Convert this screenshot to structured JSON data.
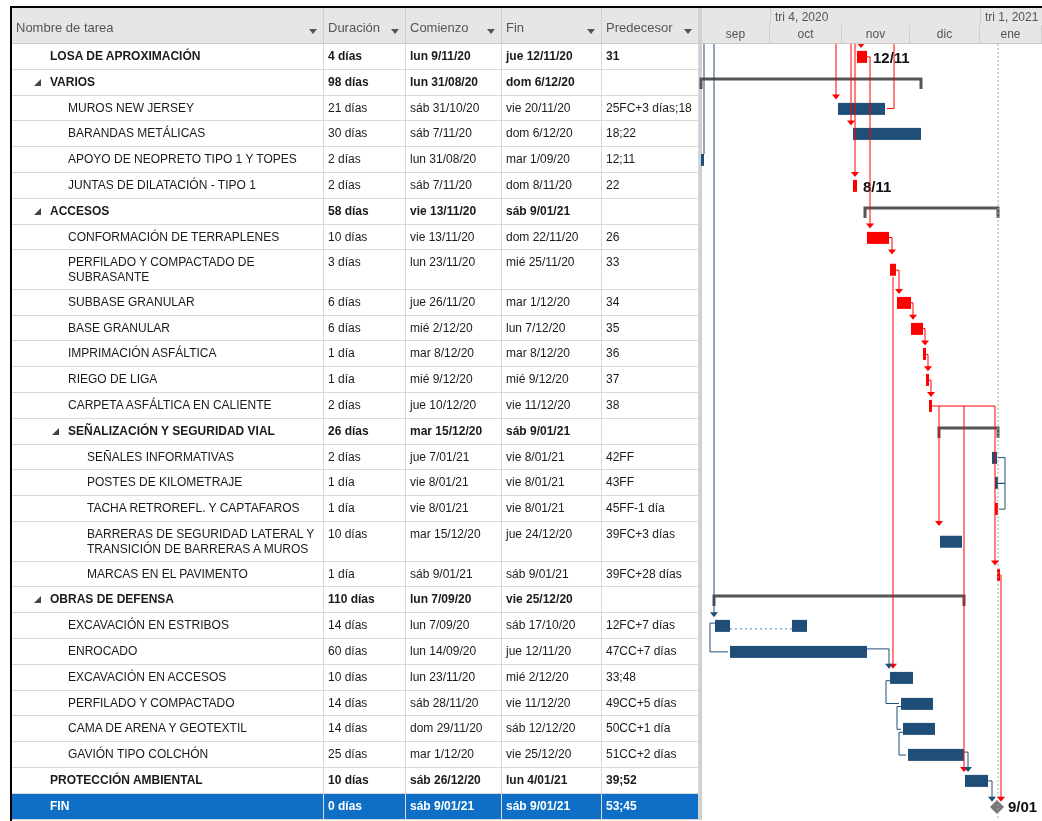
{
  "columns": [
    "Nombre de tarea",
    "Duración",
    "Comienzo",
    "Fin",
    "Predecesor"
  ],
  "timescale": {
    "quarters": [
      "tri 4, 2020",
      "tri 1, 2021"
    ],
    "months": [
      "sep",
      "oct",
      "nov",
      "dic",
      "ene"
    ]
  },
  "tasks": [
    {
      "name": "LOSA DE APROXIMACIÓN",
      "duration": "4 días",
      "start": "lun 9/11/20",
      "finish": "jue 12/11/20",
      "predecessors": "31",
      "kind": "task",
      "critical": true,
      "selected": false,
      "gantt_label": "12/11"
    },
    {
      "name": "VARIOS",
      "duration": "98 días",
      "start": "lun 31/08/20",
      "finish": "dom 6/12/20",
      "kind": "summary",
      "expanded": true,
      "selected": false,
      "children": [
        {
          "name": "MUROS NEW JERSEY",
          "duration": "21 días",
          "start": "sáb 31/10/20",
          "finish": "vie 20/11/20",
          "predecessors": "25FC+3 días;18",
          "kind": "task",
          "critical": false,
          "selected": false
        },
        {
          "name": "BARANDAS METÁLICAS",
          "duration": "30 días",
          "start": "sáb 7/11/20",
          "finish": "dom 6/12/20",
          "predecessors": "18;22",
          "kind": "task",
          "critical": false,
          "selected": false
        },
        {
          "name": "APOYO DE NEOPRETO TIPO 1 Y TOPES",
          "duration": "2 días",
          "start": "lun 31/08/20",
          "finish": "mar 1/09/20",
          "predecessors": "12;11",
          "kind": "task",
          "critical": false,
          "selected": false
        },
        {
          "name": "JUNTAS DE DILATACIÓN - TIPO 1",
          "duration": "2 días",
          "start": "sáb 7/11/20",
          "finish": "dom 8/11/20",
          "predecessors": "22",
          "kind": "task",
          "critical": true,
          "selected": false,
          "gantt_label": "8/11"
        }
      ]
    },
    {
      "name": "ACCESOS",
      "duration": "58 días",
      "start": "vie 13/11/20",
      "finish": "sáb 9/01/21",
      "kind": "summary",
      "expanded": true,
      "selected": false,
      "children": [
        {
          "name": "CONFORMACIÓN DE TERRAPLENES",
          "duration": "10 días",
          "start": "vie 13/11/20",
          "finish": "dom 22/11/20",
          "predecessors": "26",
          "kind": "task",
          "critical": true,
          "selected": false
        },
        {
          "name": "PERFILADO Y COMPACTADO DE SUBRASANTE",
          "duration": "3 días",
          "start": "lun 23/11/20",
          "finish": "mié 25/11/20",
          "predecessors": "33",
          "kind": "task",
          "critical": true,
          "selected": false
        },
        {
          "name": "SUBBASE GRANULAR",
          "duration": "6 días",
          "start": "jue 26/11/20",
          "finish": "mar 1/12/20",
          "predecessors": "34",
          "kind": "task",
          "critical": true,
          "selected": false
        },
        {
          "name": "BASE GRANULAR",
          "duration": "6 días",
          "start": "mié 2/12/20",
          "finish": "lun 7/12/20",
          "predecessors": "35",
          "kind": "task",
          "critical": true,
          "selected": false
        },
        {
          "name": "IMPRIMACIÓN ASFÁLTICA",
          "duration": "1 día",
          "start": "mar 8/12/20",
          "finish": "mar 8/12/20",
          "predecessors": "36",
          "kind": "task",
          "critical": true,
          "selected": false
        },
        {
          "name": "RIEGO DE LIGA",
          "duration": "1 día",
          "start": "mié 9/12/20",
          "finish": "mié 9/12/20",
          "predecessors": "37",
          "kind": "task",
          "critical": true,
          "selected": false
        },
        {
          "name": "CARPETA ASFÁLTICA EN CALIENTE",
          "duration": "2 días",
          "start": "jue 10/12/20",
          "finish": "vie 11/12/20",
          "predecessors": "38",
          "kind": "task",
          "critical": true,
          "selected": false
        },
        {
          "name": "SEÑALIZACIÓN Y SEGURIDAD VIAL",
          "duration": "26 días",
          "start": "mar 15/12/20",
          "finish": "sáb 9/01/21",
          "kind": "summary",
          "expanded": true,
          "selected": false,
          "children": [
            {
              "name": "SEÑALES INFORMATIVAS",
              "duration": "2 días",
              "start": "jue 7/01/21",
              "finish": "vie 8/01/21",
              "predecessors": "42FF",
              "kind": "task",
              "critical": false,
              "selected": false
            },
            {
              "name": "POSTES DE KILOMETRAJE",
              "duration": "1 día",
              "start": "vie 8/01/21",
              "finish": "vie 8/01/21",
              "predecessors": "43FF",
              "kind": "task",
              "critical": false,
              "selected": false
            },
            {
              "name": "TACHA RETROREFL. Y CAPTAFAROS",
              "duration": "1 día",
              "start": "vie 8/01/21",
              "finish": "vie 8/01/21",
              "predecessors": "45FF-1 día",
              "kind": "task",
              "critical": true,
              "selected": false
            },
            {
              "name": "BARRERAS DE SEGURIDAD LATERAL Y TRANSICIÓN DE BARRERAS A MUROS",
              "duration": "10 días",
              "start": "mar 15/12/20",
              "finish": "jue 24/12/20",
              "predecessors": "39FC+3 días",
              "kind": "task",
              "critical": false,
              "selected": false
            },
            {
              "name": "MARCAS EN EL PAVIMENTO",
              "duration": "1 día",
              "start": "sáb 9/01/21",
              "finish": "sáb 9/01/21",
              "predecessors": "39FC+28 días",
              "kind": "task",
              "critical": true,
              "selected": false
            }
          ]
        }
      ]
    },
    {
      "name": "OBRAS DE DEFENSA",
      "duration": "110 días",
      "start": "lun 7/09/20",
      "finish": "vie 25/12/20",
      "kind": "summary",
      "expanded": true,
      "selected": false,
      "children": [
        {
          "name": "EXCAVACIÓN EN ESTRIBOS",
          "duration": "14 días",
          "start": "lun 7/09/20",
          "finish": "sáb 17/10/20",
          "predecessors": "12FC+7 días",
          "kind": "task",
          "critical": false,
          "selected": false
        },
        {
          "name": "ENROCADO",
          "duration": "60 días",
          "start": "lun 14/09/20",
          "finish": "jue 12/11/20",
          "predecessors": "47CC+7 días",
          "kind": "task",
          "critical": false,
          "selected": false
        },
        {
          "name": "EXCAVACIÓN EN ACCESOS",
          "duration": "10 días",
          "start": "lun 23/11/20",
          "finish": "mié 2/12/20",
          "predecessors": "33;48",
          "kind": "task",
          "critical": false,
          "selected": false
        },
        {
          "name": "PERFILADO Y COMPACTADO",
          "duration": "14 días",
          "start": "sáb 28/11/20",
          "finish": "vie 11/12/20",
          "predecessors": "49CC+5 días",
          "kind": "task",
          "critical": false,
          "selected": false
        },
        {
          "name": "CAMA DE ARENA Y GEOTEXTIL",
          "duration": "14 días",
          "start": "dom 29/11/20",
          "finish": "sáb 12/12/20",
          "predecessors": "50CC+1 día",
          "kind": "task",
          "critical": false,
          "selected": false
        },
        {
          "name": "GAVIÓN TIPO COLCHÓN",
          "duration": "25 días",
          "start": "mar 1/12/20",
          "finish": "vie 25/12/20",
          "predecessors": "51CC+2 días",
          "kind": "task",
          "critical": false,
          "selected": false
        }
      ]
    },
    {
      "name": "PROTECCIÓN AMBIENTAL",
      "duration": "10 días",
      "start": "sáb 26/12/20",
      "finish": "lun 4/01/21",
      "predecessors": "39;52",
      "kind": "task",
      "critical": false,
      "selected": false
    },
    {
      "name": "FIN",
      "duration": "0 días",
      "start": "sáb 9/01/21",
      "finish": "sáb 9/01/21",
      "predecessors": "53;45",
      "kind": "milestone",
      "critical": false,
      "selected": true,
      "gantt_label": "9/01"
    }
  ]
}
